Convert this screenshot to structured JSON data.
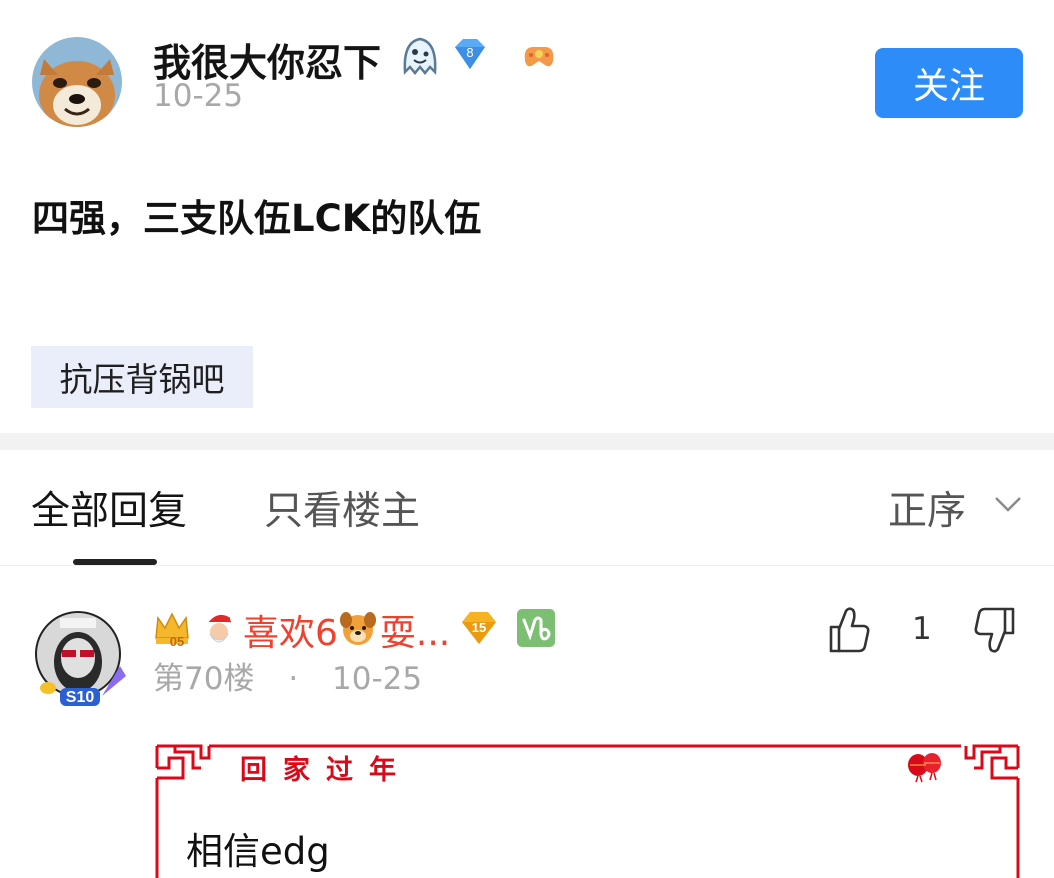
{
  "post": {
    "username": "我很大你忍下",
    "date": "10-25",
    "level_badge": "8",
    "follow_label": "关注",
    "content": "四强，三支队伍LCK的队伍",
    "topic_tag": "抗压背锅吧"
  },
  "tabs": {
    "all_replies": "全部回复",
    "op_only": "只看楼主",
    "sort_label": "正序"
  },
  "reply": {
    "crown_level": "05",
    "name": "喜欢6",
    "name_suffix": "耍...",
    "level_badge": "15",
    "floor": "第70楼",
    "separator": "·",
    "date": "10-25",
    "like_count": "1",
    "frame_title": "回家过年",
    "avatar_badge": "S10",
    "content": "相信edg"
  },
  "colors": {
    "follow_button": "#2d8cf7",
    "topic_tag_bg": "#e9eefa",
    "reply_name": "#f0412f",
    "frame_red": "#d9091a",
    "level_badge_blue": "#5aa9f5",
    "level_badge_gold": "#f5b324",
    "zodiac_green": "#7cbf73"
  },
  "icons": [
    "ghost-emoji-icon",
    "diamond-level-icon",
    "gamepad-icon",
    "crown-icon",
    "santa-emoji-icon",
    "dog-emoji-icon",
    "capricorn-icon",
    "thumbs-up-icon",
    "thumbs-down-icon",
    "chevron-down-icon",
    "lantern-icon"
  ]
}
